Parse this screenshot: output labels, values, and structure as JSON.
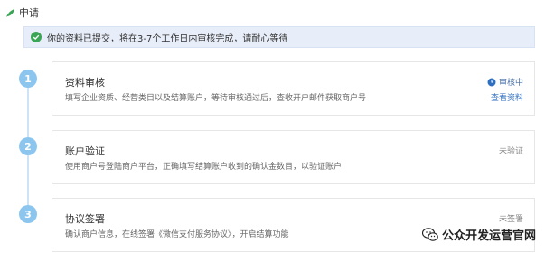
{
  "header": {
    "title": "申请"
  },
  "notice": {
    "text": "你的资料已提交，将在3-7个工作日内审核完成，请耐心等待"
  },
  "steps": [
    {
      "number": "1",
      "title": "资料审核",
      "description": "填写企业资质、经营类目以及结算账户，等待审核通过后，查收开户邮件获取商户号",
      "status": "审核中",
      "link": "查看资料"
    },
    {
      "number": "2",
      "title": "账户验证",
      "description": "使用商户号登陆商户平台，正确填写结算账户收到的确认金数目，以验证账户",
      "status": "未验证"
    },
    {
      "number": "3",
      "title": "协议签署",
      "description": "确认商户信息，在线签署《微信支付服务协议》，开启结算功能",
      "status": "未签署"
    }
  ],
  "watermark": {
    "text": "公众开发运营官网"
  },
  "colors": {
    "accent": "#2f6fc0",
    "step_circle": "#8cc6ef",
    "notice_bg": "#e8eef9",
    "success": "#3aa655"
  }
}
